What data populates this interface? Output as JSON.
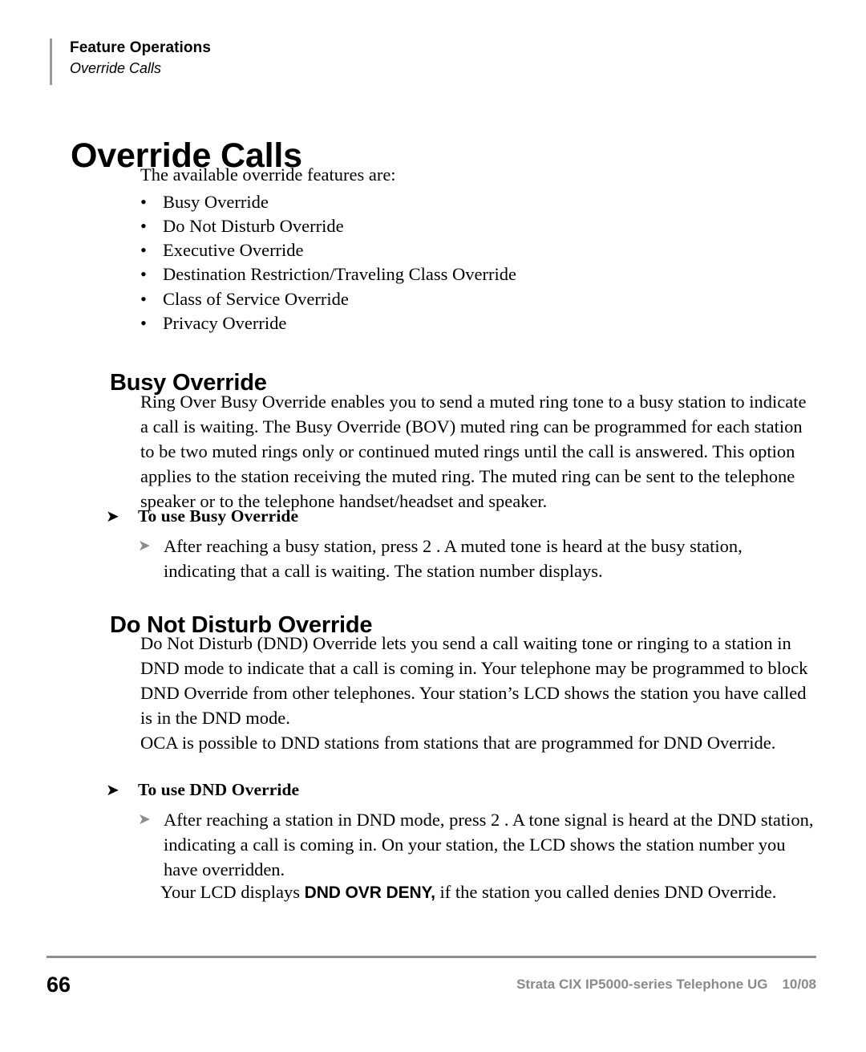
{
  "document": {
    "running_header": {
      "chapter": "Feature Operations",
      "section": "Override Calls"
    },
    "page_title": "Override Calls",
    "intro": "The available override features are:",
    "bullet_mark": "•",
    "feature_list": [
      "Busy Override",
      "Do Not Disturb Override",
      "Executive Override",
      "Destination Restriction/Traveling Class Override",
      "Class of Service Override",
      "Privacy Override"
    ],
    "sections": [
      {
        "heading": "Busy Override",
        "body": "Ring Over Busy Override enables you to send a muted ring tone to a busy station to indicate a call is waiting. The Busy Override (BOV) muted ring can be programmed for each station to be two muted rings only or continued muted rings until the call is answered. This option applies to the station receiving the muted ring. The muted ring can be sent to the telephone speaker or to the telephone handset/headset and speaker.",
        "procedure_heading": "To use Busy Override",
        "procedure_step": "After reaching a busy station, press 2 . A muted tone is heard at the busy station, indicating that a call is waiting. The station number displays."
      },
      {
        "heading": "Do Not Disturb Override",
        "body": "Do Not Disturb (DND) Override lets you send a call waiting tone or ringing to a station in DND mode to indicate that a call is coming in. Your telephone may be programmed to block DND Override from other telephones. Your station’s LCD shows the station you have called is in the DND mode.",
        "body2": "OCA is possible to DND stations from stations that are programmed for DND Override.",
        "procedure_heading": "To use DND Override",
        "procedure_step": "After reaching a station in DND mode, press 2 . A tone signal is heard at the DND station, indicating a call is coming in. On your station, the LCD shows the station number you have overridden.",
        "note_prefix": "Your LCD displays ",
        "note_emphasis": "DND OVR DENY,",
        "note_suffix": " if the station you called denies DND Override."
      }
    ],
    "arrow_glyph": "➤",
    "footer": {
      "page_number": "66",
      "publication": "Strata CIX IP5000-series Telephone UG",
      "date": "10/08"
    },
    "colors": {
      "rule_gray": "#8e8e8e",
      "footer_text_gray": "#8a8a8a",
      "step_arrow_gray": "#8d8d8d",
      "text_black": "#000000",
      "page_background": "#ffffff"
    }
  }
}
